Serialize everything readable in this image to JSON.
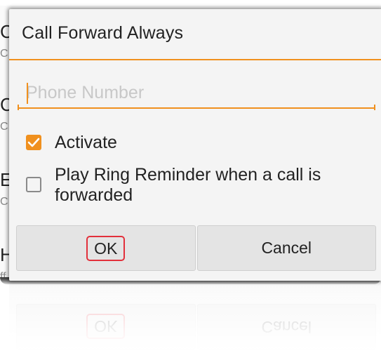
{
  "background": {
    "letters": [
      "C",
      "C",
      "C",
      "E",
      "H"
    ],
    "subletters": [
      "C",
      "C",
      "C",
      "ff"
    ]
  },
  "dialog": {
    "title": "Call Forward Always",
    "phone_input": {
      "placeholder": "Phone Number",
      "value": ""
    },
    "options": [
      {
        "label": "Activate",
        "checked": true
      },
      {
        "label": "Play Ring Reminder when a call is forwarded",
        "checked": false
      }
    ],
    "buttons": {
      "ok": "OK",
      "cancel": "Cancel"
    }
  },
  "colors": {
    "accent": "#f0901e",
    "highlight": "#e2303b"
  },
  "icons": {
    "checkmark": "checkmark-icon"
  }
}
